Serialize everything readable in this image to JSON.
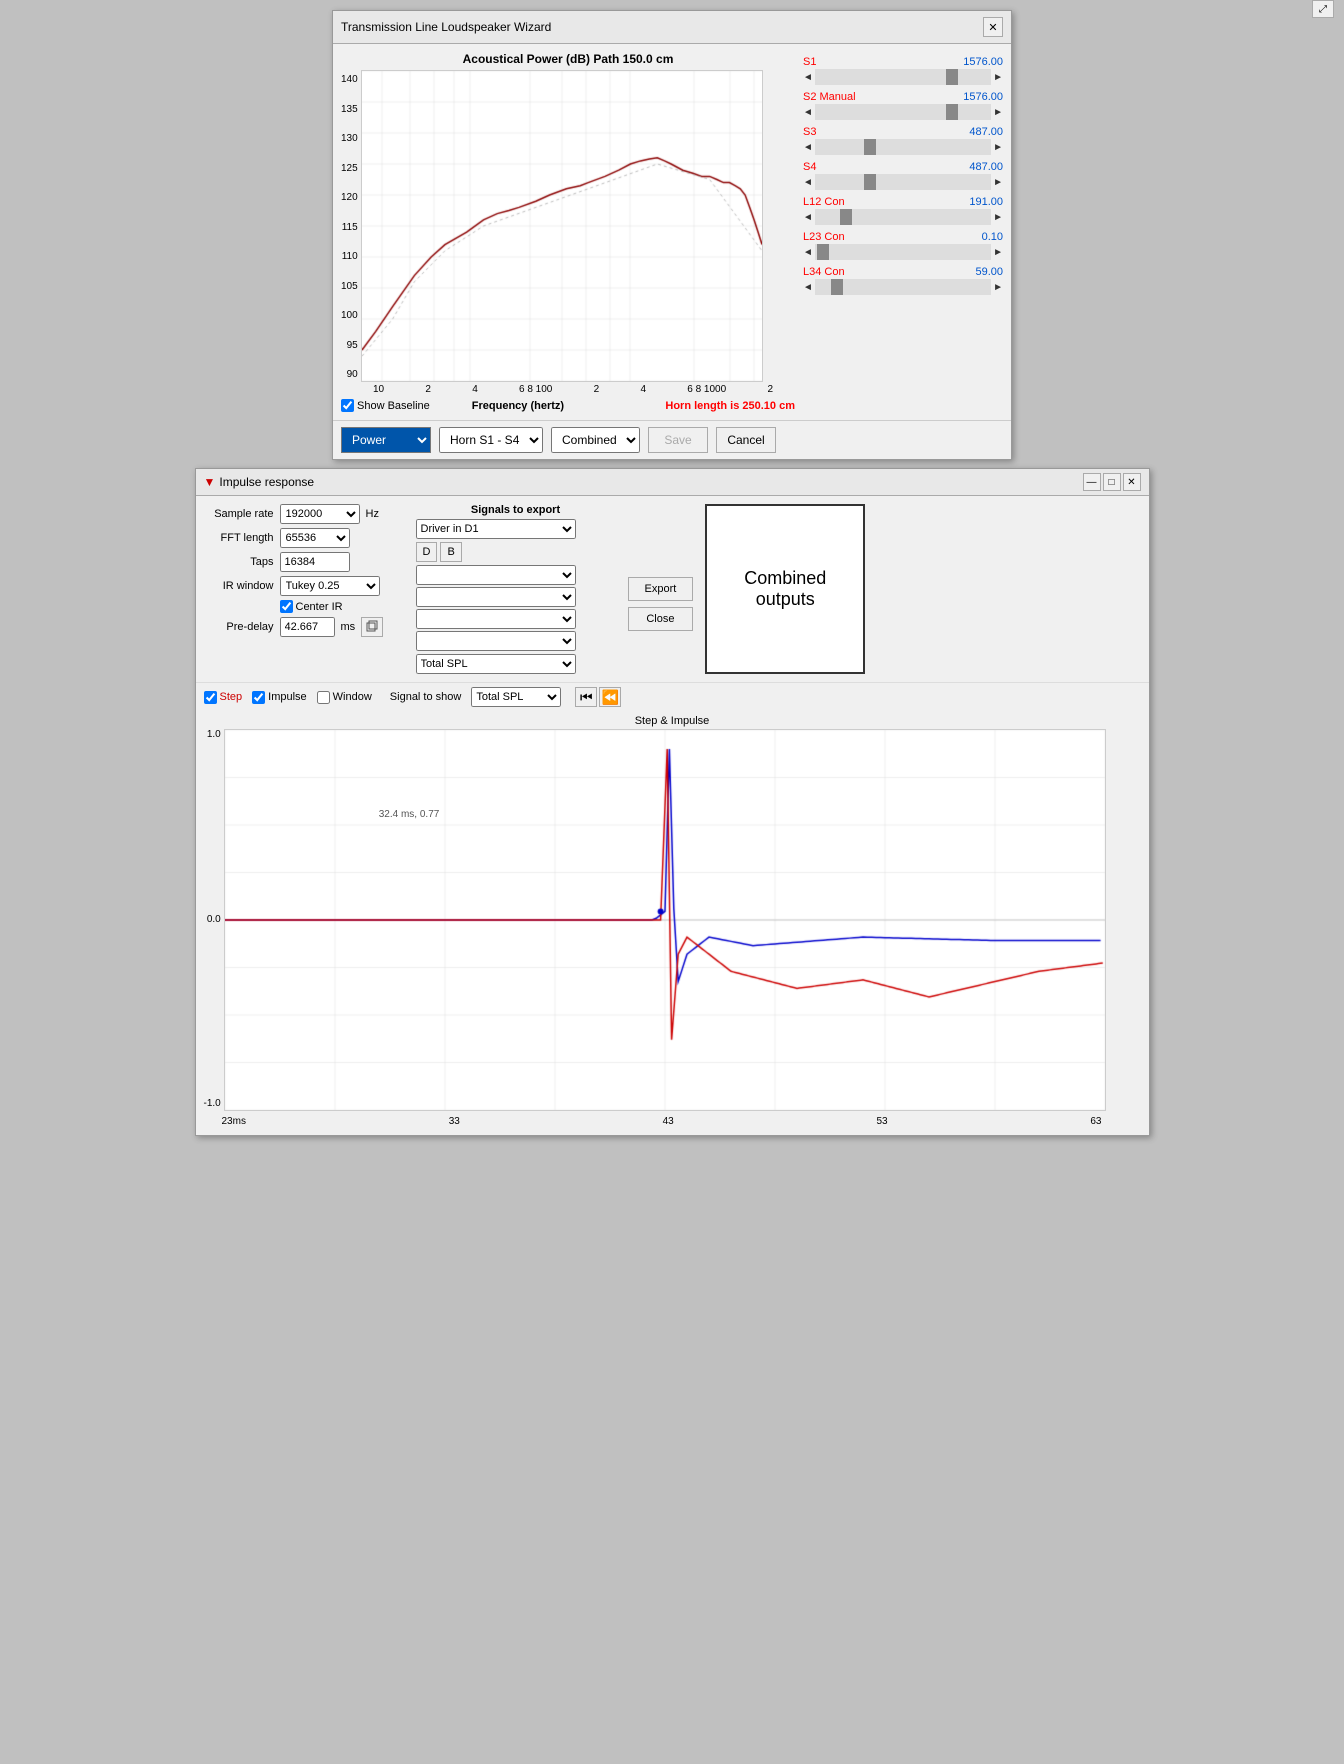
{
  "wizard": {
    "title": "Transmission Line Loudspeaker Wizard",
    "chart": {
      "title": "Acoustical Power (dB)   Path 150.0 cm",
      "y_labels": [
        "140",
        "135",
        "130",
        "125",
        "120",
        "115",
        "110",
        "105",
        "100",
        "95",
        "90"
      ],
      "x_labels": [
        "10",
        "2",
        "4",
        "6 8 100",
        "2",
        "4",
        "6 8 1000",
        "2"
      ],
      "frequency_label": "Frequency (hertz)",
      "horn_length": "Horn length is 250.10 cm"
    },
    "show_baseline": "Show Baseline",
    "sliders": [
      {
        "label": "S1",
        "value": "1576.00"
      },
      {
        "label": "S2 Manual",
        "value": "1576.00"
      },
      {
        "label": "S3",
        "value": "487.00"
      },
      {
        "label": "S4",
        "value": "487.00"
      },
      {
        "label": "L12 Con",
        "value": "191.00"
      },
      {
        "label": "L23 Con",
        "value": "0.10"
      },
      {
        "label": "L34 Con",
        "value": "59.00"
      }
    ],
    "toolbar": {
      "power_label": "Power",
      "horn_s1_s4": "Horn S1 - S4",
      "combined": "Combined",
      "save_label": "Save",
      "cancel_label": "Cancel"
    }
  },
  "impulse": {
    "title": "Impulse response",
    "controls": {
      "sample_rate_label": "Sample rate",
      "sample_rate_value": "192000",
      "sample_rate_unit": "Hz",
      "fft_label": "FFT length",
      "fft_value": "65536",
      "taps_label": "Taps",
      "taps_value": "16384",
      "ir_window_label": "IR window",
      "ir_window_value": "Tukey 0.25",
      "center_ir_label": "Center IR",
      "pre_delay_label": "Pre-delay",
      "pre_delay_value": "42.667",
      "pre_delay_unit": "ms"
    },
    "signals": {
      "label": "Signals to export",
      "default_signal": "Driver in D1",
      "d_btn": "D",
      "b_btn": "B",
      "total_spl": "Total SPL"
    },
    "buttons": {
      "export": "Export",
      "close": "Close"
    },
    "combined_outputs": "Combined\noutputs",
    "checkbar": {
      "step_label": "Step",
      "impulse_label": "Impulse",
      "window_label": "Window",
      "signal_to_show_label": "Signal to show",
      "total_spl": "Total SPL"
    },
    "chart": {
      "title": "Step & Impulse",
      "annotation": "32.4 ms, 0.77",
      "y_labels": [
        "1.0",
        "0.0",
        "-1.0"
      ],
      "x_labels": [
        "23ms",
        "33",
        "43",
        "53",
        "63"
      ]
    }
  }
}
